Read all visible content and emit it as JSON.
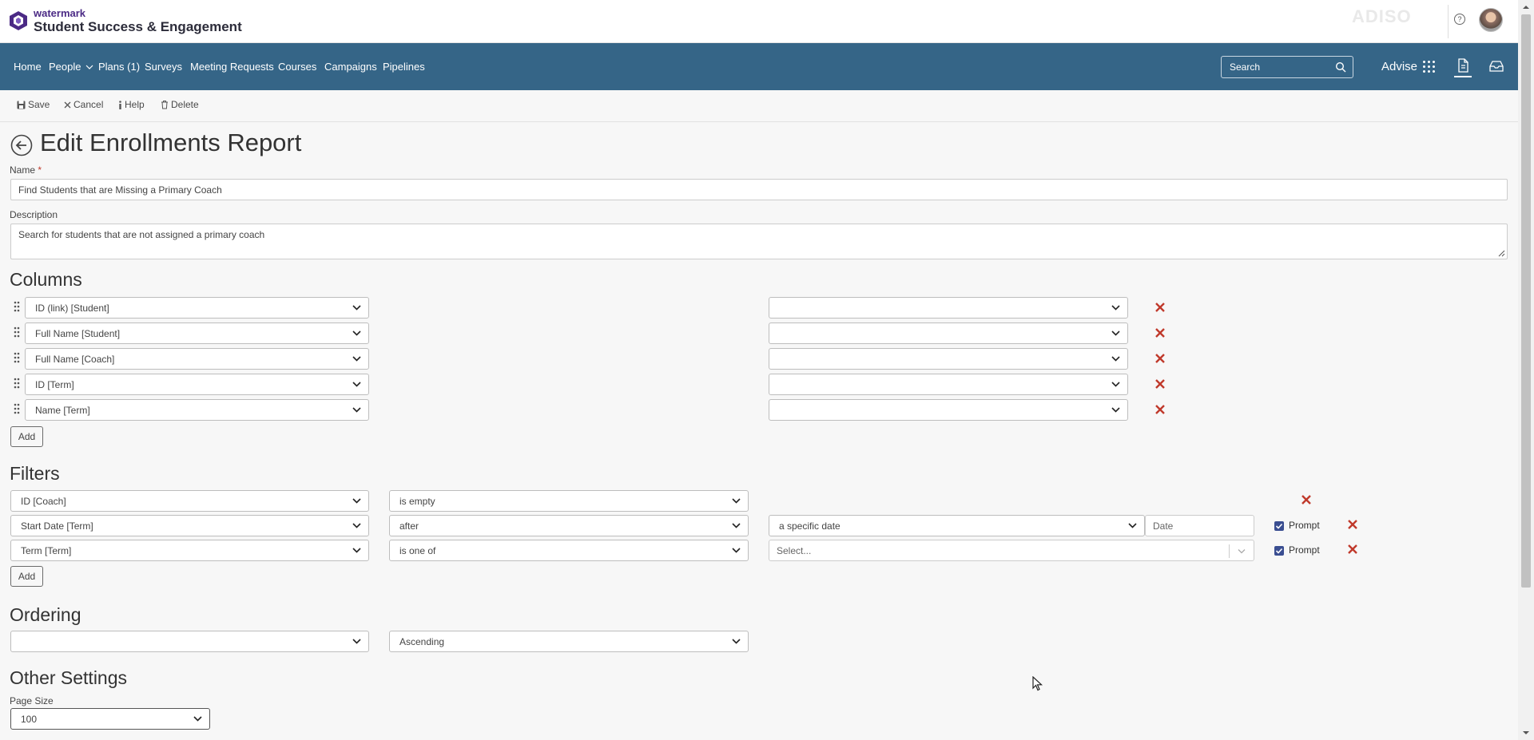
{
  "brand": {
    "small": "watermark",
    "big": "Student Success & Engagement"
  },
  "faint_logo": "ADISO",
  "nav": {
    "items": [
      "Home",
      "People",
      "Plans (1)",
      "Surveys",
      "Meeting Requests",
      "Courses",
      "Campaigns",
      "Pipelines"
    ],
    "search_placeholder": "Search",
    "advise": "Advise"
  },
  "toolbar": {
    "save": "Save",
    "cancel": "Cancel",
    "help": "Help",
    "delete": "Delete"
  },
  "page": {
    "title": "Edit Enrollments Report",
    "name_label": "Name",
    "name_required": "*",
    "name_value": "Find Students that are Missing a Primary Coach",
    "description_label": "Description",
    "description_value": "Search for students that are not assigned a primary coach"
  },
  "columns": {
    "heading": "Columns",
    "rows": [
      "ID (link) [Student]",
      "Full Name [Student]",
      "Full Name [Coach]",
      "ID [Term]",
      "Name [Term]"
    ],
    "add": "Add"
  },
  "filters": {
    "heading": "Filters",
    "rows": [
      {
        "field": "ID [Coach]",
        "operator": "is empty"
      },
      {
        "field": "Start Date [Term]",
        "operator": "after",
        "value_type": "a specific date",
        "date_placeholder": "Date",
        "prompt": "Prompt",
        "prompt_checked": true
      },
      {
        "field": "Term [Term]",
        "operator": "is one of",
        "select_placeholder": "Select...",
        "prompt": "Prompt",
        "prompt_checked": true
      }
    ],
    "add": "Add"
  },
  "ordering": {
    "heading": "Ordering",
    "field": "",
    "direction": "Ascending"
  },
  "other_settings": {
    "heading": "Other Settings",
    "page_size_label": "Page Size",
    "page_size_value": "100"
  },
  "colors": {
    "nav_bg": "#356587",
    "brand_purple": "#4b2a85",
    "delete_red": "#c0392b",
    "checkbox": "#3a4e91"
  }
}
